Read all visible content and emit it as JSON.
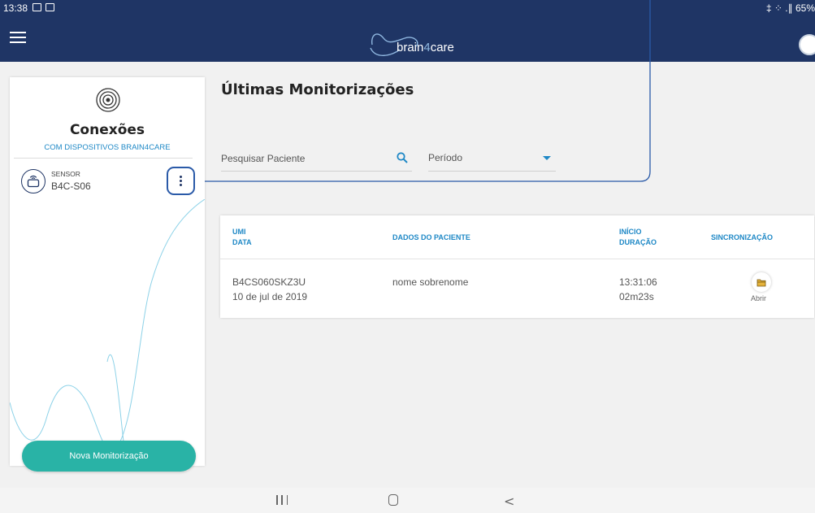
{
  "status_bar": {
    "time": "13:38",
    "right": "‡ ⁘ .∥ 65%"
  },
  "app": {
    "brand_prefix": "brain",
    "brand_digit": "4",
    "brand_suffix": "care"
  },
  "sidebar": {
    "title": "Conexões",
    "subtitle": "COM DISPOSITIVOS BRAIN4CARE",
    "sensor_label": "SENSOR",
    "sensor_name": "B4C-S06",
    "new_button": "Nova Monitorização"
  },
  "main": {
    "title": "Últimas Monitorizações",
    "search_placeholder": "Pesquisar Paciente",
    "period_label": "Período"
  },
  "table": {
    "headers": {
      "umi": "UMI",
      "data": "DATA",
      "patient": "DADOS DO PACIENTE",
      "start": "INÍCIO",
      "duration": "DURAÇÃO",
      "sync": "SINCRONIZAÇÃO"
    },
    "rows": [
      {
        "umi": "B4CS060SKZ3U",
        "date": "10 de jul de 2019",
        "patient": "nome sobrenome",
        "start": "13:31:06",
        "duration": "02m23s",
        "action": "Abrir"
      }
    ]
  },
  "colors": {
    "appbar": "#1f3565",
    "accent": "#1e88c6",
    "primary_button": "#29b3a6",
    "highlight": "#2a5aa8"
  },
  "icons": [
    "menu-icon",
    "signal-icon",
    "sensor-icon",
    "kebab-icon",
    "search-icon",
    "caret-down-icon",
    "folder-icon",
    "nav-recent-icon",
    "nav-home-icon",
    "nav-back-icon"
  ]
}
